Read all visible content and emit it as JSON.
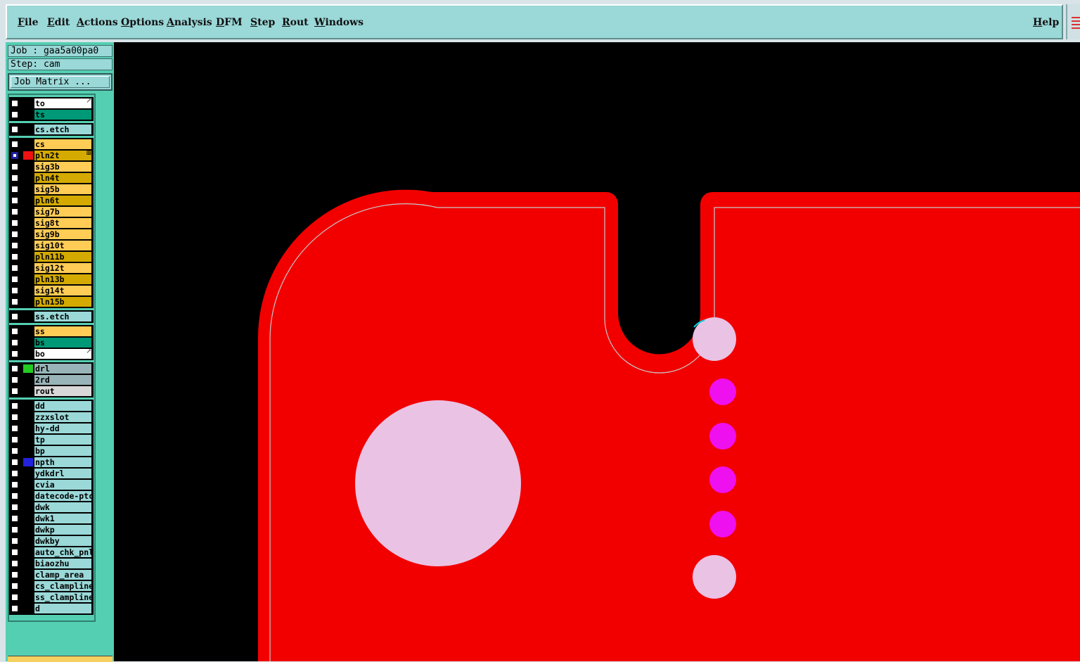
{
  "menubar": {
    "items": [
      "File",
      "Edit",
      "Actions",
      "Options",
      "Analysis",
      "DFM",
      "Step",
      "Rout",
      "Windows"
    ],
    "help": "Help"
  },
  "info": {
    "job": "Job : gaa5a00pa0",
    "step": "Step: cam",
    "job_matrix": "Job Matrix ..."
  },
  "colors": {
    "board_red": "#f20000",
    "drill_pink": "#eac2e4",
    "via_magenta": "#ee10ee",
    "panel_green": "#55cfb2",
    "signal_orange": "#ffcc55",
    "plane_gold": "#d4aa00",
    "mask_green": "#009977",
    "row_cyan": "#9bd8d8"
  },
  "layers": [
    {
      "name": "to",
      "bg": "#ffffff",
      "swatch": "",
      "arrow": "↗"
    },
    {
      "name": "ts",
      "bg": "#009977",
      "swatch": ""
    },
    {
      "name": "cs.etch",
      "bg": "#9bd8d8",
      "swatch": ""
    },
    {
      "name": "cs",
      "bg": "#ffcc55",
      "swatch": ""
    },
    {
      "name": "pln2t",
      "bg": "#d4aa00",
      "swatch": "#ee1111",
      "selected": true,
      "arrow": "⊞"
    },
    {
      "name": "sig3b",
      "bg": "#ffcc55",
      "swatch": ""
    },
    {
      "name": "pln4t",
      "bg": "#d4aa00",
      "swatch": ""
    },
    {
      "name": "sig5b",
      "bg": "#ffcc55",
      "swatch": ""
    },
    {
      "name": "pln6t",
      "bg": "#d4aa00",
      "swatch": ""
    },
    {
      "name": "sig7b",
      "bg": "#ffcc55",
      "swatch": ""
    },
    {
      "name": "sig8t",
      "bg": "#ffcc55",
      "swatch": ""
    },
    {
      "name": "sig9b",
      "bg": "#ffcc55",
      "swatch": ""
    },
    {
      "name": "sig10t",
      "bg": "#ffcc55",
      "swatch": ""
    },
    {
      "name": "pln11b",
      "bg": "#d4aa00",
      "swatch": ""
    },
    {
      "name": "sig12t",
      "bg": "#ffcc55",
      "swatch": ""
    },
    {
      "name": "pln13b",
      "bg": "#d4aa00",
      "swatch": ""
    },
    {
      "name": "sig14t",
      "bg": "#ffcc55",
      "swatch": ""
    },
    {
      "name": "pln15b",
      "bg": "#d4aa00",
      "swatch": ""
    },
    {
      "name": "ss.etch",
      "bg": "#9bd8d8",
      "swatch": ""
    },
    {
      "name": "ss",
      "bg": "#ffcc55",
      "swatch": ""
    },
    {
      "name": "bs",
      "bg": "#009977",
      "swatch": ""
    },
    {
      "name": "bo",
      "bg": "#ffffff",
      "swatch": "",
      "arrow": "↗"
    },
    {
      "name": "drl",
      "bg": "#98b4b8",
      "swatch": "#22cc22"
    },
    {
      "name": "2rd",
      "bg": "#98b4b8",
      "swatch": ""
    },
    {
      "name": "rout",
      "bg": "#d8d8d8",
      "swatch": ""
    },
    {
      "name": "dd",
      "bg": "#9bd8d8",
      "swatch": ""
    },
    {
      "name": "zzxslot",
      "bg": "#9bd8d8",
      "swatch": ""
    },
    {
      "name": "hy-dd",
      "bg": "#9bd8d8",
      "swatch": ""
    },
    {
      "name": "tp",
      "bg": "#9bd8d8",
      "swatch": ""
    },
    {
      "name": "bp",
      "bg": "#9bd8d8",
      "swatch": ""
    },
    {
      "name": "npth",
      "bg": "#9bd8d8",
      "swatch": "#2222dd"
    },
    {
      "name": "ydkdrl",
      "bg": "#9bd8d8",
      "swatch": ""
    },
    {
      "name": "cvia",
      "bg": "#9bd8d8",
      "swatch": ""
    },
    {
      "name": "datecode-ptc",
      "bg": "#9bd8d8",
      "swatch": ""
    },
    {
      "name": "dwk",
      "bg": "#9bd8d8",
      "swatch": ""
    },
    {
      "name": "dwk1",
      "bg": "#9bd8d8",
      "swatch": ""
    },
    {
      "name": "dwkp",
      "bg": "#9bd8d8",
      "swatch": ""
    },
    {
      "name": "dwkby",
      "bg": "#9bd8d8",
      "swatch": ""
    },
    {
      "name": "auto_chk_pnl",
      "bg": "#9bd8d8",
      "swatch": ""
    },
    {
      "name": "biaozhu",
      "bg": "#9bd8d8",
      "swatch": ""
    },
    {
      "name": "clamp_area",
      "bg": "#9bd8d8",
      "swatch": ""
    },
    {
      "name": "cs_clampline",
      "bg": "#9bd8d8",
      "swatch": ""
    },
    {
      "name": "ss_clampline",
      "bg": "#9bd8d8",
      "swatch": ""
    },
    {
      "name": "d",
      "bg": "#9bd8d8",
      "swatch": ""
    }
  ]
}
